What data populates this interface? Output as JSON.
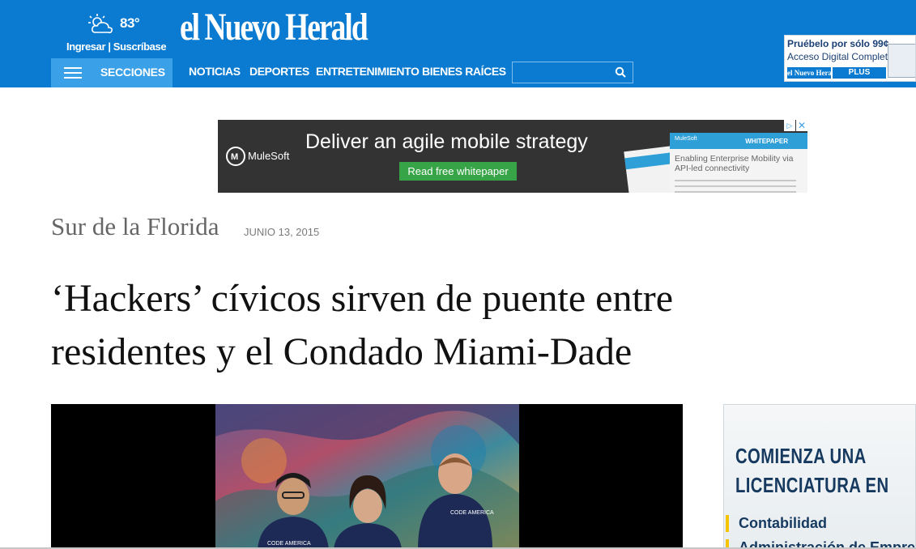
{
  "header": {
    "temperature": "83°",
    "login": "Ingresar",
    "separator": "|",
    "subscribe": "Suscríbase",
    "logo": "el Nuevo Herald",
    "sections_label": "SECCIONES",
    "nav": [
      "NOTICIAS",
      "DEPORTES",
      "ENTRETENIMIENTO",
      "BIENES RAÍCES"
    ],
    "search_placeholder": "",
    "promo": {
      "line1": "Pruébelo por sólo 99¢",
      "line2": "Acceso Digital Completo",
      "logo": "el Nuevo Herald",
      "plus": "PLUS"
    }
  },
  "ad": {
    "brand": "MuleSoft",
    "headline": "Deliver an agile mobile strategy",
    "cta": "Read free whitepaper",
    "paper_brand": "MuleSoft",
    "paper_label": "WHITEPAPER",
    "paper_text": "Enabling Enterprise Mobility via API-led connectivity",
    "choices_icon": "▷",
    "close_icon": "✕"
  },
  "article": {
    "section": "Sur de la Florida",
    "date": "JUNIO 13, 2015",
    "headline": "‘Hackers’ cívicos sirven de puente entre residentes y el Condado Miami-Dade",
    "photo_badges": [
      "CODE AMERICA",
      "CODE AMERICA"
    ]
  },
  "side_ad": {
    "line1": "COMIENZA UNA",
    "line2": "LICENCIATURA EN",
    "items": [
      "Contabilidad",
      "Administración de Empresas"
    ]
  },
  "colors": {
    "header_blue": "#0a7bd0",
    "secciones_blue": "#3aa0e8",
    "ad_green": "#37a447",
    "side_navy": "#16395f",
    "accent_yellow": "#f5c400"
  }
}
